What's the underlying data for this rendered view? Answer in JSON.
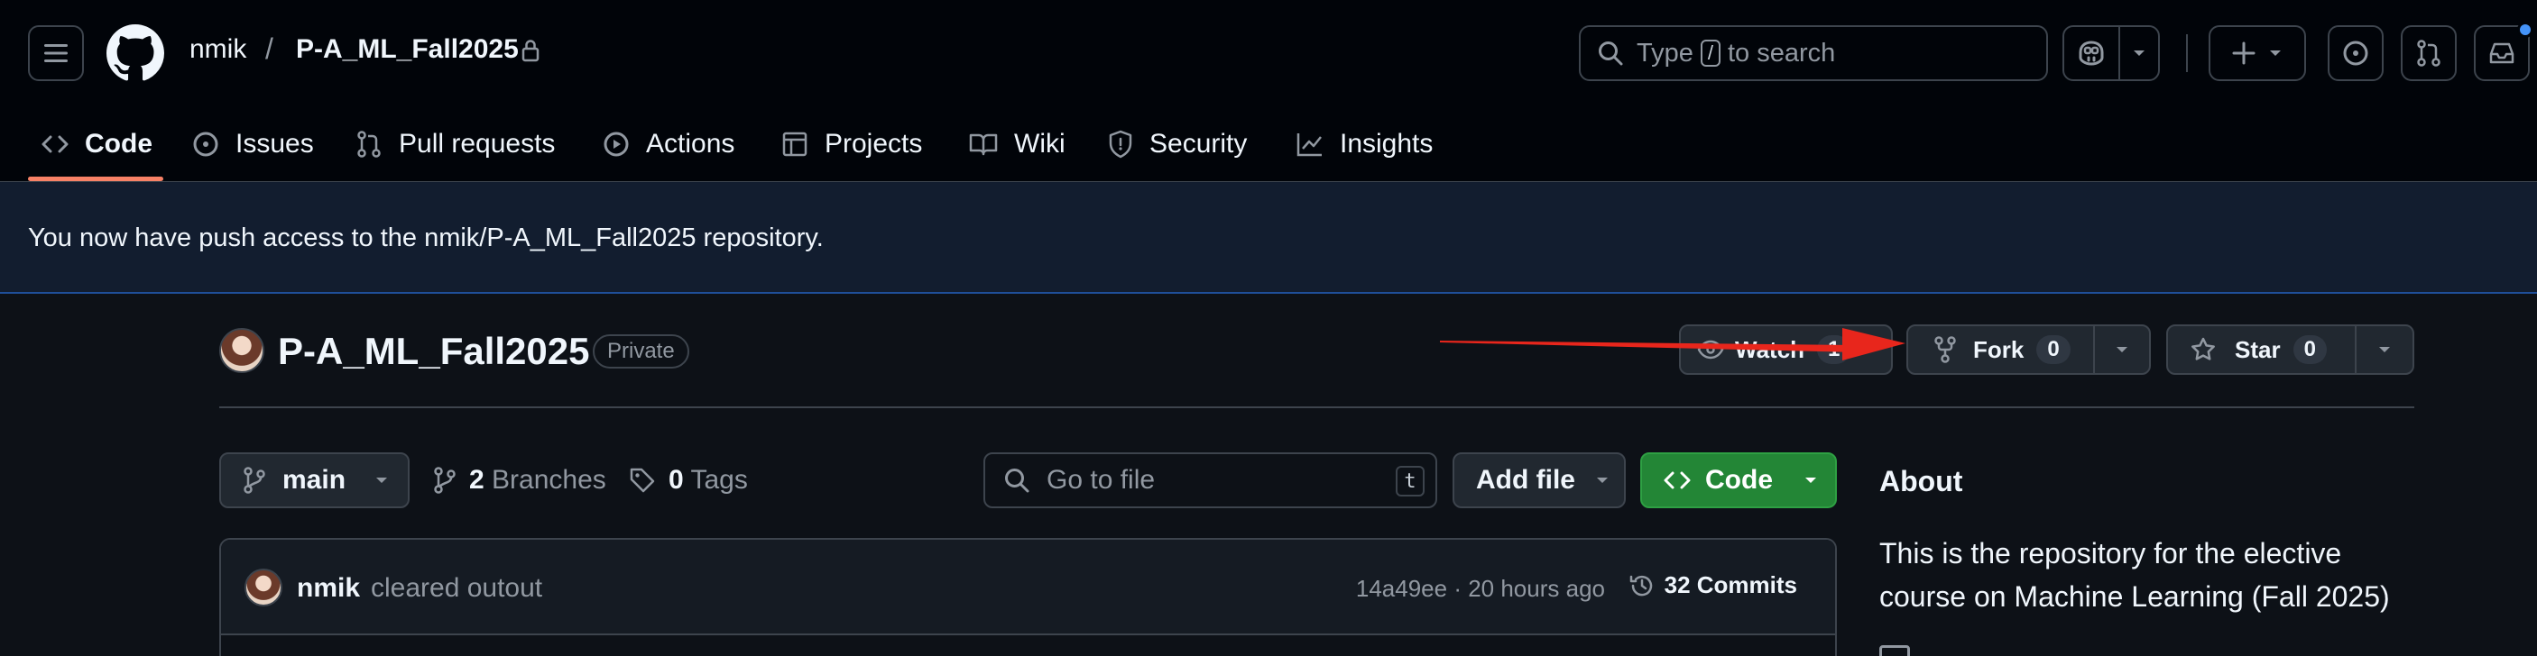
{
  "header": {
    "owner": "nmik",
    "separator": "/",
    "repo": "P-A_ML_Fall2025",
    "search": {
      "prefix": "Type",
      "key": "/",
      "suffix": "to search"
    }
  },
  "tabs": [
    {
      "label": "Code",
      "icon": "code-icon",
      "active": true
    },
    {
      "label": "Issues",
      "icon": "issue-icon"
    },
    {
      "label": "Pull requests",
      "icon": "pull-request-icon"
    },
    {
      "label": "Actions",
      "icon": "play-icon"
    },
    {
      "label": "Projects",
      "icon": "table-icon"
    },
    {
      "label": "Wiki",
      "icon": "book-icon"
    },
    {
      "label": "Security",
      "icon": "shield-icon"
    },
    {
      "label": "Insights",
      "icon": "graph-icon"
    }
  ],
  "flash": {
    "message": "You now have push access to the nmik/P-A_ML_Fall2025 repository."
  },
  "repo_header": {
    "title": "P-A_ML_Fall2025",
    "visibility": "Private",
    "watch": {
      "label": "Watch",
      "count": "1"
    },
    "fork": {
      "label": "Fork",
      "count": "0"
    },
    "star": {
      "label": "Star",
      "count": "0"
    }
  },
  "toolbar": {
    "branch": "main",
    "branches": {
      "count": "2",
      "label": "Branches"
    },
    "tags": {
      "count": "0",
      "label": "Tags"
    },
    "goto_placeholder": "Go to file",
    "goto_key": "t",
    "add_file": "Add file",
    "code": "Code"
  },
  "latest_commit": {
    "author": "nmik",
    "message": "cleared outout",
    "hash_time": "14a49ee · 20 hours ago",
    "commits": "32 Commits"
  },
  "about": {
    "title": "About",
    "description": "This is the repository for the elective course on Machine Learning (Fall 2025)"
  },
  "colors": {
    "header_bg": "#010409",
    "page_bg": "#0d1117",
    "flash_bg": "#121d2f",
    "code_button": "#238636",
    "active_tab_underline": "#f78166",
    "annotation_arrow": "#e8261c"
  }
}
